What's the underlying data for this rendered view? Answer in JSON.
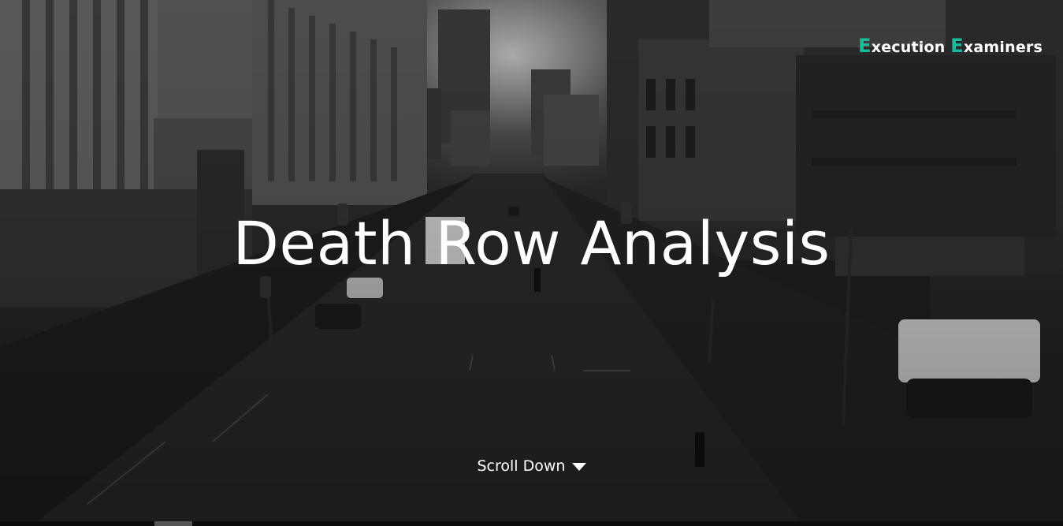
{
  "brand": {
    "first_initial": "E",
    "first_rest": "xecution",
    "second_initial": "E",
    "second_rest": "xaminers"
  },
  "hero": {
    "title": "Death Row Analysis",
    "scroll_label": "Scroll Down",
    "scroll_icon": "caret-down-icon",
    "background_image": "grayscale city street photo"
  },
  "colors": {
    "accent": "#1abc9c",
    "text": "#ffffff"
  }
}
